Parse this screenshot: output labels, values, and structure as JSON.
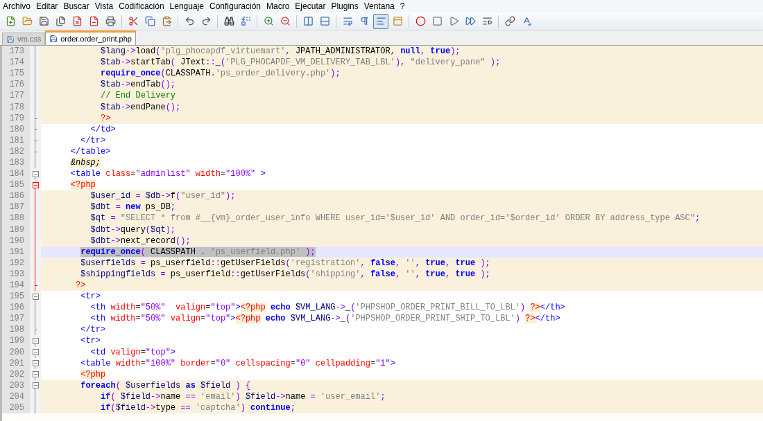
{
  "menu": [
    "Archivo",
    "Editar",
    "Buscar",
    "Vista",
    "Codificación",
    "Lenguaje",
    "Configuración",
    "Macro",
    "Ejecutar",
    "Plugins",
    "Ventana",
    "?"
  ],
  "toolbar": [
    {
      "pressed": false
    },
    {
      "pressed": false
    },
    {
      "pressed": false
    },
    {
      "pressed": false
    },
    {
      "pressed": false
    },
    {
      "pressed": false
    },
    {
      "pressed": false
    },
    {
      "pressed": false
    },
    {
      "pressed": false
    },
    {
      "pressed": false
    },
    {
      "pressed": false
    },
    {
      "pressed": false
    },
    {
      "pressed": false
    },
    {
      "pressed": false
    },
    {
      "pressed": false
    },
    {
      "pressed": false
    },
    {
      "pressed": false
    },
    {
      "pressed": false
    },
    {
      "pressed": false
    },
    {
      "pressed": false
    },
    {
      "pressed": true
    },
    {
      "pressed": false
    },
    {
      "pressed": false
    },
    {
      "pressed": false
    },
    {
      "pressed": false
    },
    {
      "pressed": false
    },
    {
      "pressed": false
    },
    {
      "pressed": false
    },
    {
      "pressed": false
    }
  ],
  "tabs": [
    {
      "label": "vm.css",
      "selected": false
    },
    {
      "label": "order.order_print.php",
      "selected": true
    }
  ],
  "lines": [
    {
      "number": "173",
      "kind": "line",
      "php": true,
      "current": false,
      "selection": false,
      "tokens": [
        {
          "kind": "var",
          "text": "          $lang"
        },
        {
          "kind": "op",
          "text": "->"
        },
        {
          "kind": "plain",
          "text": "load"
        },
        {
          "kind": "op",
          "text": "("
        },
        {
          "kind": "str",
          "text": "'plg_phocapdf_virtuemart'"
        },
        {
          "kind": "op",
          "text": ","
        },
        {
          "kind": "plain",
          "text": " JPATH_ADMINISTRATOR"
        },
        {
          "kind": "op",
          "text": ", "
        },
        {
          "kind": "kw",
          "text": "null"
        },
        {
          "kind": "op",
          "text": ", "
        },
        {
          "kind": "kw",
          "text": "true"
        },
        {
          "kind": "op",
          "text": ");"
        }
      ]
    },
    {
      "number": "174",
      "kind": "line",
      "php": true,
      "current": false,
      "selection": false,
      "tokens": [
        {
          "kind": "var",
          "text": "          $tab"
        },
        {
          "kind": "op",
          "text": "->"
        },
        {
          "kind": "plain",
          "text": "startTab"
        },
        {
          "kind": "op",
          "text": "("
        },
        {
          "kind": "plain",
          "text": " JText"
        },
        {
          "kind": "op",
          "text": "::"
        },
        {
          "kind": "plain",
          "text": "_"
        },
        {
          "kind": "op",
          "text": "("
        },
        {
          "kind": "str",
          "text": "'PLG_PHOCAPDF_VM_DELIVERY_TAB_LBL'"
        },
        {
          "kind": "op",
          "text": "), "
        },
        {
          "kind": "str",
          "text": "\"delivery_pane\" "
        },
        {
          "kind": "op",
          "text": ");"
        }
      ]
    },
    {
      "number": "175",
      "kind": "line",
      "php": true,
      "current": false,
      "selection": false,
      "tokens": [
        {
          "kind": "kw",
          "text": "          require_once"
        },
        {
          "kind": "op",
          "text": "("
        },
        {
          "kind": "plain",
          "text": "CLASSPATH"
        },
        {
          "kind": "op",
          "text": "."
        },
        {
          "kind": "str",
          "text": "'ps_order_delivery.php'"
        },
        {
          "kind": "op",
          "text": ");"
        }
      ]
    },
    {
      "number": "176",
      "kind": "line",
      "php": true,
      "current": false,
      "selection": false,
      "tokens": [
        {
          "kind": "var",
          "text": "          $tab"
        },
        {
          "kind": "op",
          "text": "->"
        },
        {
          "kind": "plain",
          "text": "endTab"
        },
        {
          "kind": "op",
          "text": "();"
        }
      ]
    },
    {
      "number": "177",
      "kind": "line",
      "php": true,
      "current": false,
      "selection": false,
      "tokens": [
        {
          "kind": "comment",
          "text": "          // End Delivery"
        }
      ]
    },
    {
      "number": "178",
      "kind": "line",
      "php": true,
      "current": false,
      "selection": false,
      "tokens": [
        {
          "kind": "var",
          "text": "          $tab"
        },
        {
          "kind": "op",
          "text": "->"
        },
        {
          "kind": "plain",
          "text": "endPane"
        },
        {
          "kind": "op",
          "text": "();"
        }
      ]
    },
    {
      "number": "179",
      "kind": "tick",
      "php": true,
      "current": false,
      "selection": false,
      "tokens": [
        {
          "kind": "php",
          "text": "          ?>"
        }
      ]
    },
    {
      "number": "180",
      "kind": "tick",
      "php": false,
      "current": false,
      "selection": false,
      "tokens": [
        {
          "kind": "tag",
          "text": "        </td>"
        }
      ]
    },
    {
      "number": "181",
      "kind": "tick",
      "php": false,
      "current": false,
      "selection": false,
      "tokens": [
        {
          "kind": "tag",
          "text": "      </tr>"
        }
      ]
    },
    {
      "number": "182",
      "kind": "tick",
      "php": false,
      "current": false,
      "selection": false,
      "tokens": [
        {
          "kind": "tag",
          "text": "    </table>"
        }
      ]
    },
    {
      "number": "183",
      "kind": "line",
      "php": false,
      "current": false,
      "selection": false,
      "tokens": [
        {
          "kind": "entity",
          "text": "    &nbsp;"
        }
      ]
    },
    {
      "number": "184",
      "kind": "box",
      "php": false,
      "current": false,
      "selection": false,
      "tokens": [
        {
          "kind": "tag",
          "text": "    <table"
        },
        {
          "kind": "attr",
          "text": " class"
        },
        {
          "kind": "plain",
          "text": "="
        },
        {
          "kind": "val",
          "text": "\"adminlist\""
        },
        {
          "kind": "attr",
          "text": " width"
        },
        {
          "kind": "plain",
          "text": "="
        },
        {
          "kind": "val",
          "text": "\"100%\""
        },
        {
          "kind": "tag",
          "text": " >"
        }
      ]
    },
    {
      "number": "185",
      "kind": "box_active",
      "php": false,
      "current": false,
      "selection": false,
      "tokens": [
        {
          "kind": "php",
          "text": "    <?php"
        }
      ]
    },
    {
      "number": "186",
      "kind": "line_active",
      "php": true,
      "current": false,
      "selection": false,
      "tokens": [
        {
          "kind": "var",
          "text": "        $user_id "
        },
        {
          "kind": "op",
          "text": "= "
        },
        {
          "kind": "var",
          "text": "$db"
        },
        {
          "kind": "op",
          "text": "->"
        },
        {
          "kind": "plain",
          "text": "f"
        },
        {
          "kind": "op",
          "text": "("
        },
        {
          "kind": "str",
          "text": "\"user_id\""
        },
        {
          "kind": "op",
          "text": ");"
        }
      ]
    },
    {
      "number": "187",
      "kind": "line_active",
      "php": true,
      "current": false,
      "selection": false,
      "tokens": [
        {
          "kind": "var",
          "text": "        $dbt "
        },
        {
          "kind": "op",
          "text": "= "
        },
        {
          "kind": "kw",
          "text": "new"
        },
        {
          "kind": "plain",
          "text": " ps_DB"
        },
        {
          "kind": "op",
          "text": ";"
        }
      ]
    },
    {
      "number": "188",
      "kind": "line_active",
      "php": true,
      "current": false,
      "selection": false,
      "tokens": [
        {
          "kind": "var",
          "text": "        $qt "
        },
        {
          "kind": "op",
          "text": "= "
        },
        {
          "kind": "str",
          "text": "\"SELECT * from #__{vm}_order_user_info WHERE user_id='$user_id' AND order_id='$order_id' ORDER BY address_type ASC\""
        },
        {
          "kind": "op",
          "text": ";"
        }
      ]
    },
    {
      "number": "189",
      "kind": "line_active",
      "php": true,
      "current": false,
      "selection": false,
      "tokens": [
        {
          "kind": "var",
          "text": "        $dbt"
        },
        {
          "kind": "op",
          "text": "->"
        },
        {
          "kind": "plain",
          "text": "query"
        },
        {
          "kind": "op",
          "text": "("
        },
        {
          "kind": "var",
          "text": "$qt"
        },
        {
          "kind": "op",
          "text": ");"
        }
      ]
    },
    {
      "number": "190",
      "kind": "line_active",
      "php": true,
      "current": false,
      "selection": false,
      "tokens": [
        {
          "kind": "var",
          "text": "        $dbt"
        },
        {
          "kind": "op",
          "text": "->"
        },
        {
          "kind": "plain",
          "text": "next_record"
        },
        {
          "kind": "op",
          "text": "();"
        }
      ]
    },
    {
      "number": "191",
      "kind": "line_active",
      "current": true,
      "selection": true,
      "tokens": [
        {
          "kind": "kw",
          "text": "      require_once"
        },
        {
          "kind": "op",
          "text": "("
        },
        {
          "kind": "plain",
          "text": " CLASSPATH "
        },
        {
          "kind": "op",
          "text": ". "
        },
        {
          "kind": "str",
          "text": "'ps_userfield.php' "
        },
        {
          "kind": "op",
          "text": ");"
        }
      ]
    },
    {
      "number": "192",
      "kind": "line_active",
      "php": true,
      "current": false,
      "selection": false,
      "tokens": [
        {
          "kind": "var",
          "text": "      $userfields "
        },
        {
          "kind": "op",
          "text": "="
        },
        {
          "kind": "plain",
          "text": " ps_userfield"
        },
        {
          "kind": "op",
          "text": "::"
        },
        {
          "kind": "plain",
          "text": "getUserFields"
        },
        {
          "kind": "op",
          "text": "("
        },
        {
          "kind": "str",
          "text": "'registration'"
        },
        {
          "kind": "op",
          "text": ", "
        },
        {
          "kind": "kw",
          "text": "false"
        },
        {
          "kind": "op",
          "text": ", "
        },
        {
          "kind": "str",
          "text": "''"
        },
        {
          "kind": "op",
          "text": ", "
        },
        {
          "kind": "kw",
          "text": "true"
        },
        {
          "kind": "op",
          "text": ", "
        },
        {
          "kind": "kw",
          "text": "true "
        },
        {
          "kind": "op",
          "text": ");"
        }
      ]
    },
    {
      "number": "193",
      "kind": "line_active",
      "php": true,
      "current": false,
      "selection": false,
      "tokens": [
        {
          "kind": "var",
          "text": "      $shippingfields "
        },
        {
          "kind": "op",
          "text": "="
        },
        {
          "kind": "plain",
          "text": " ps_userfield"
        },
        {
          "kind": "op",
          "text": "::"
        },
        {
          "kind": "plain",
          "text": "getUserFields"
        },
        {
          "kind": "op",
          "text": "("
        },
        {
          "kind": "str",
          "text": "'shipping'"
        },
        {
          "kind": "op",
          "text": ", "
        },
        {
          "kind": "kw",
          "text": "false"
        },
        {
          "kind": "op",
          "text": ", "
        },
        {
          "kind": "str",
          "text": "''"
        },
        {
          "kind": "op",
          "text": ", "
        },
        {
          "kind": "kw",
          "text": "true"
        },
        {
          "kind": "op",
          "text": ", "
        },
        {
          "kind": "kw",
          "text": "true "
        },
        {
          "kind": "op",
          "text": ");"
        }
      ]
    },
    {
      "number": "194",
      "kind": "end_active",
      "php": true,
      "current": false,
      "selection": false,
      "tokens": [
        {
          "kind": "php",
          "text": "     ?>"
        }
      ]
    },
    {
      "number": "195",
      "kind": "box",
      "php": false,
      "current": false,
      "selection": false,
      "tokens": [
        {
          "kind": "tag",
          "text": "      <tr>"
        }
      ]
    },
    {
      "number": "196",
      "kind": "line",
      "php": false,
      "current": false,
      "selection": false,
      "tokens": [
        {
          "kind": "tag",
          "text": "        <th"
        },
        {
          "kind": "attr",
          "text": " width"
        },
        {
          "kind": "plain",
          "text": "="
        },
        {
          "kind": "val",
          "text": "\"50%\""
        },
        {
          "kind": "attr",
          "text": "  valign"
        },
        {
          "kind": "plain",
          "text": "="
        },
        {
          "kind": "val",
          "text": "\"top\""
        },
        {
          "kind": "tag",
          "text": ">"
        },
        {
          "kind": "php",
          "text": "<?php"
        },
        {
          "kind": "kw",
          "text": " echo"
        },
        {
          "kind": "var",
          "text": " $VM_LANG"
        },
        {
          "kind": "op",
          "text": "->"
        },
        {
          "kind": "plain",
          "text": "_"
        },
        {
          "kind": "op",
          "text": "("
        },
        {
          "kind": "str",
          "text": "'PHPSHOP_ORDER_PRINT_BILL_TO_LBL'"
        },
        {
          "kind": "op",
          "text": ") "
        },
        {
          "kind": "php",
          "text": "?>"
        },
        {
          "kind": "tag",
          "text": "</th>"
        }
      ]
    },
    {
      "number": "197",
      "kind": "line",
      "php": false,
      "current": false,
      "selection": false,
      "tokens": [
        {
          "kind": "tag",
          "text": "        <th"
        },
        {
          "kind": "attr",
          "text": " width"
        },
        {
          "kind": "plain",
          "text": "="
        },
        {
          "kind": "val",
          "text": "\"50%\""
        },
        {
          "kind": "attr",
          "text": " valign"
        },
        {
          "kind": "plain",
          "text": "="
        },
        {
          "kind": "val",
          "text": "\"top\""
        },
        {
          "kind": "tag",
          "text": ">"
        },
        {
          "kind": "php",
          "text": "<?php"
        },
        {
          "kind": "kw",
          "text": " echo"
        },
        {
          "kind": "var",
          "text": " $VM_LANG"
        },
        {
          "kind": "op",
          "text": "->"
        },
        {
          "kind": "plain",
          "text": "_"
        },
        {
          "kind": "op",
          "text": "("
        },
        {
          "kind": "str",
          "text": "'PHPSHOP_ORDER_PRINT_SHIP_TO_LBL'"
        },
        {
          "kind": "op",
          "text": ") "
        },
        {
          "kind": "php",
          "text": "?>"
        },
        {
          "kind": "tag",
          "text": "</th>"
        }
      ]
    },
    {
      "number": "198",
      "kind": "tick",
      "php": false,
      "current": false,
      "selection": false,
      "tokens": [
        {
          "kind": "tag",
          "text": "      </tr>"
        }
      ]
    },
    {
      "number": "199",
      "kind": "box",
      "php": false,
      "current": false,
      "selection": false,
      "tokens": [
        {
          "kind": "tag",
          "text": "      <tr>"
        }
      ]
    },
    {
      "number": "200",
      "kind": "box",
      "php": false,
      "current": false,
      "selection": false,
      "tokens": [
        {
          "kind": "tag",
          "text": "        <td"
        },
        {
          "kind": "attr",
          "text": " valign"
        },
        {
          "kind": "plain",
          "text": "="
        },
        {
          "kind": "val",
          "text": "\"top\""
        },
        {
          "kind": "tag",
          "text": ">"
        }
      ]
    },
    {
      "number": "201",
      "kind": "box",
      "php": false,
      "current": false,
      "selection": false,
      "tokens": [
        {
          "kind": "tag",
          "text": "      <table"
        },
        {
          "kind": "attr",
          "text": " width"
        },
        {
          "kind": "plain",
          "text": "="
        },
        {
          "kind": "val",
          "text": "\"100%\""
        },
        {
          "kind": "attr",
          "text": " border"
        },
        {
          "kind": "plain",
          "text": "="
        },
        {
          "kind": "val",
          "text": "\"0\""
        },
        {
          "kind": "attr",
          "text": " cellspacing"
        },
        {
          "kind": "plain",
          "text": "="
        },
        {
          "kind": "val",
          "text": "\"0\""
        },
        {
          "kind": "attr",
          "text": " cellpadding"
        },
        {
          "kind": "plain",
          "text": "="
        },
        {
          "kind": "val",
          "text": "\"1\""
        },
        {
          "kind": "tag",
          "text": ">"
        }
      ]
    },
    {
      "number": "202",
      "kind": "box",
      "php": false,
      "current": false,
      "selection": false,
      "tokens": [
        {
          "kind": "php",
          "text": "      <?php"
        }
      ]
    },
    {
      "number": "203",
      "kind": "box",
      "php": true,
      "current": false,
      "selection": false,
      "tokens": [
        {
          "kind": "kw",
          "text": "      foreach"
        },
        {
          "kind": "op",
          "text": "( "
        },
        {
          "kind": "var",
          "text": "$userfields "
        },
        {
          "kind": "kw",
          "text": "as"
        },
        {
          "kind": "var",
          "text": " $field "
        },
        {
          "kind": "op",
          "text": ") {"
        }
      ]
    },
    {
      "number": "204",
      "kind": "line",
      "php": true,
      "current": false,
      "selection": false,
      "tokens": [
        {
          "kind": "kw",
          "text": "          if"
        },
        {
          "kind": "op",
          "text": "( "
        },
        {
          "kind": "var",
          "text": "$field"
        },
        {
          "kind": "op",
          "text": "->"
        },
        {
          "kind": "plain",
          "text": "name "
        },
        {
          "kind": "op",
          "text": "== "
        },
        {
          "kind": "str",
          "text": "'email'"
        },
        {
          "kind": "op",
          "text": ") "
        },
        {
          "kind": "var",
          "text": "$field"
        },
        {
          "kind": "op",
          "text": "->"
        },
        {
          "kind": "plain",
          "text": "name "
        },
        {
          "kind": "op",
          "text": "= "
        },
        {
          "kind": "str",
          "text": "'user_email'"
        },
        {
          "kind": "op",
          "text": ";"
        }
      ]
    },
    {
      "number": "205",
      "kind": "line",
      "php": true,
      "current": false,
      "selection": false,
      "tokens": [
        {
          "kind": "kw",
          "text": "          if"
        },
        {
          "kind": "op",
          "text": "("
        },
        {
          "kind": "var",
          "text": "$field"
        },
        {
          "kind": "op",
          "text": "->"
        },
        {
          "kind": "plain",
          "text": "type "
        },
        {
          "kind": "op",
          "text": "== "
        },
        {
          "kind": "str",
          "text": "'captcha'"
        },
        {
          "kind": "op",
          "text": ") "
        },
        {
          "kind": "kw",
          "text": "continue"
        },
        {
          "kind": "op",
          "text": ";"
        }
      ]
    }
  ]
}
